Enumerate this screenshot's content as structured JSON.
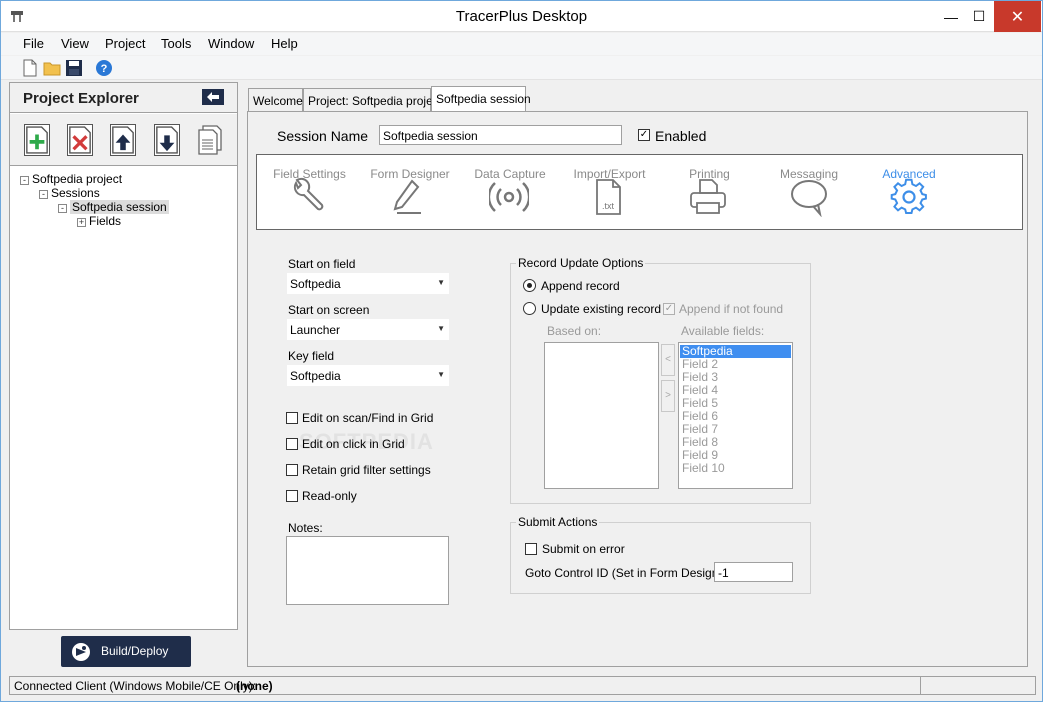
{
  "window": {
    "title": "TracerPlus Desktop",
    "minimize": "—",
    "maximize": "☐",
    "close": "✕"
  },
  "menu": [
    "File",
    "View",
    "Project",
    "Tools",
    "Window",
    "Help"
  ],
  "toolbar": {
    "icons": [
      "new-file-icon",
      "open-folder-icon",
      "save-icon",
      "help-icon"
    ]
  },
  "explorer": {
    "title": "Project Explorer",
    "collapse": "🡐",
    "tools": [
      "add-icon",
      "delete-icon",
      "move-up-icon",
      "move-down-icon",
      "copy-icon"
    ],
    "tree": [
      {
        "label": "Softpedia project",
        "expander": "-"
      },
      {
        "label": "Sessions",
        "expander": "-"
      },
      {
        "label": "Softpedia session",
        "expander": "-",
        "selected": true
      },
      {
        "label": "Fields",
        "expander": "+"
      }
    ]
  },
  "build_button": "Build/Deploy",
  "status": {
    "label": "Connected Client (Windows Mobile/CE Only):",
    "value": "(none)"
  },
  "tabs": [
    "Welcome",
    "Project: Softpedia project",
    "Softpedia session"
  ],
  "session": {
    "name_label": "Session Name",
    "name_value": "Softpedia session",
    "enabled_label": "Enabled",
    "enabled": true
  },
  "nav": {
    "items": [
      "Field Settings",
      "Form Designer",
      "Data Capture",
      "Import/Export",
      "Printing",
      "Messaging",
      "Advanced"
    ],
    "active": "Advanced",
    "accent": "#3d8ee8",
    "txt_label": ".txt"
  },
  "form": {
    "start_field_label": "Start on field",
    "start_field_value": "Softpedia",
    "start_screen_label": "Start on screen",
    "start_screen_value": "Launcher",
    "key_field_label": "Key field",
    "key_field_value": "Softpedia",
    "checkboxes": [
      "Edit on scan/Find in Grid",
      "Edit on click in Grid",
      "Retain grid filter settings",
      "Read-only"
    ],
    "notes_label": "Notes:"
  },
  "record_update": {
    "title": "Record Update Options",
    "append": "Append record",
    "update": "Update existing record",
    "append_if_not_found": "Append if not found",
    "based_on": "Based on:",
    "available_fields": "Available fields:",
    "fields": [
      "Softpedia",
      "Field 2",
      "Field 3",
      "Field 4",
      "Field 5",
      "Field 6",
      "Field 7",
      "Field 8",
      "Field 9",
      "Field 10"
    ],
    "move_left": "<",
    "move_right": ">"
  },
  "submit_actions": {
    "title": "Submit Actions",
    "submit_on_error": "Submit on error",
    "goto_label": "Goto Control ID (Set in Form Designer)",
    "goto_value": "-1"
  },
  "watermark": "SOFTPEDIA"
}
